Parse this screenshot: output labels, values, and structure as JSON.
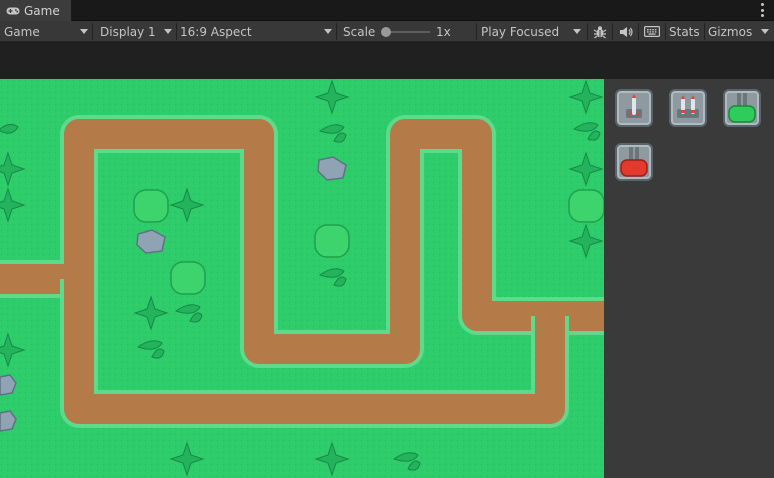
{
  "tab": {
    "title": "Game",
    "icon": "gamepad-icon"
  },
  "toolbar": {
    "view_mode": "Game",
    "display": "Display 1",
    "aspect": "16:9 Aspect",
    "scale_label": "Scale",
    "scale_value": "1x",
    "scale_level": 0,
    "play_mode": "Play Focused",
    "stats_label": "Stats",
    "gizmos_label": "Gizmos",
    "icons": [
      "bug-icon",
      "speaker-icon",
      "keyboard-icon"
    ]
  },
  "game": {
    "colors": {
      "grass": "#2ecc6a",
      "path_dirt": "#b47a48",
      "path_edge": "#9a663c",
      "bush": "#3dd46e",
      "rock": "#8fa3b4"
    },
    "tower_panel": {
      "towers": [
        {
          "name": "single-rocket-tower",
          "icon": "rocket-icon"
        },
        {
          "name": "double-rocket-tower",
          "icon": "double-rocket-icon"
        },
        {
          "name": "green-cannon-tower",
          "icon": "cannon-icon"
        },
        {
          "name": "red-cannon-tower",
          "icon": "cannon-icon"
        }
      ]
    }
  }
}
